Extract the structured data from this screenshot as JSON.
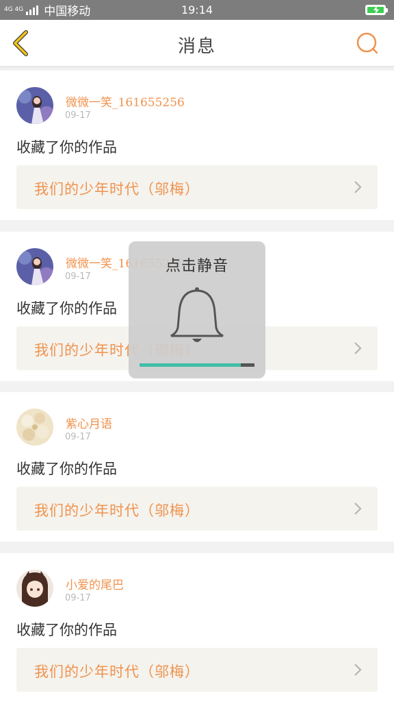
{
  "status_bar": {
    "network_type": "4G 4G",
    "carrier": "中国移动",
    "time": "19:14",
    "battery_icon": "battery-charging-icon"
  },
  "header": {
    "title": "消息",
    "back_icon": "chevron-left-icon",
    "search_icon": "search-icon"
  },
  "colors": {
    "accent": "#f0924d",
    "back_icon": "#f2c31b",
    "toast_progress": "#3fbfa8"
  },
  "messages": [
    {
      "user": "微微一笑_161655256",
      "date": "09-17",
      "action": "收藏了你的作品",
      "work_title": "我们的少年时代（邬梅）",
      "avatar_icon": "avatar-girl-image"
    },
    {
      "user": "微微一笑_161655256",
      "date": "09-17",
      "action": "收藏了你的作品",
      "work_title": "我们的少年时代（邬梅）",
      "avatar_icon": "avatar-girl-image"
    },
    {
      "user": "紫心月语",
      "date": "09-17",
      "action": "收藏了你的作品",
      "work_title": "我们的少年时代（邬梅）",
      "avatar_icon": "avatar-flowers-image"
    },
    {
      "user": "小爱的尾巴",
      "date": "09-17",
      "action": "收藏了你的作品",
      "work_title": "我们的少年时代（邬梅）",
      "avatar_icon": "avatar-anime-image"
    }
  ],
  "mute_toast": {
    "label": "点击静音",
    "icon": "bell-icon",
    "volume_fraction": 0.88
  }
}
